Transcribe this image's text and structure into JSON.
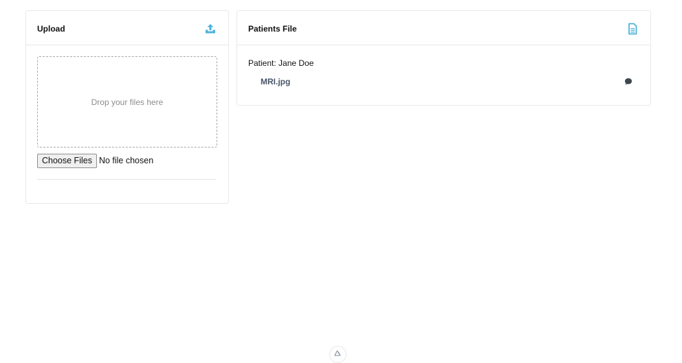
{
  "upload_card": {
    "title": "Upload",
    "header_icon": "upload-icon",
    "dropzone_text": "Drop your files here",
    "choose_files_label": "Choose Files",
    "file_status": "No file chosen"
  },
  "patients_card": {
    "title": "Patients File",
    "header_icon": "document-icon",
    "patient_label": "Patient: Jane Doe",
    "files": [
      {
        "name": "MRI.jpg",
        "action_icon": "comment-icon"
      }
    ]
  },
  "footer": {
    "logo_icon": "nuxt-logo-icon"
  },
  "colors": {
    "accent": "#4fb3d9",
    "link": "#4a5568",
    "border": "#e6e8eb"
  }
}
